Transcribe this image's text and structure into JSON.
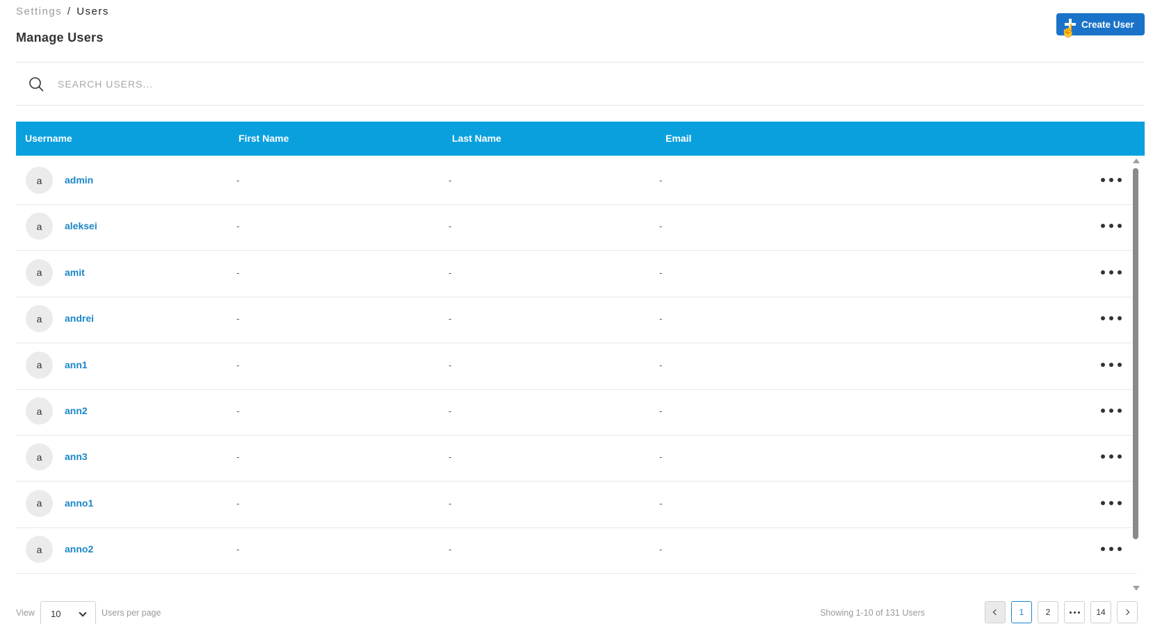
{
  "breadcrumb": {
    "parent": "Settings",
    "separator": "/",
    "current": "Users"
  },
  "page_title": "Manage Users",
  "create_button": {
    "label": "Create User",
    "icon": "plus-icon"
  },
  "search": {
    "placeholder": "SEARCH USERS...",
    "value": "",
    "icon": "search-icon"
  },
  "table": {
    "columns": [
      "Username",
      "First Name",
      "Last Name",
      "Email"
    ],
    "rows": [
      {
        "avatar": "a",
        "username": "admin",
        "first_name": "-",
        "last_name": "-",
        "email": "-"
      },
      {
        "avatar": "a",
        "username": "aleksei",
        "first_name": "-",
        "last_name": "-",
        "email": "-"
      },
      {
        "avatar": "a",
        "username": "amit",
        "first_name": "-",
        "last_name": "-",
        "email": "-"
      },
      {
        "avatar": "a",
        "username": "andrei",
        "first_name": "-",
        "last_name": "-",
        "email": "-"
      },
      {
        "avatar": "a",
        "username": "ann1",
        "first_name": "-",
        "last_name": "-",
        "email": "-"
      },
      {
        "avatar": "a",
        "username": "ann2",
        "first_name": "-",
        "last_name": "-",
        "email": "-"
      },
      {
        "avatar": "a",
        "username": "ann3",
        "first_name": "-",
        "last_name": "-",
        "email": "-"
      },
      {
        "avatar": "a",
        "username": "anno1",
        "first_name": "-",
        "last_name": "-",
        "email": "-"
      },
      {
        "avatar": "a",
        "username": "anno2",
        "first_name": "-",
        "last_name": "-",
        "email": "-"
      }
    ]
  },
  "footer": {
    "view_label": "View",
    "per_page_value": "10",
    "per_page_label": "Users per page",
    "showing_text": "Showing 1-10 of 131 Users",
    "pages": [
      "1",
      "2",
      "14"
    ],
    "current_page": "1"
  },
  "colors": {
    "header_bg": "#0aa0de",
    "primary_button": "#1a73c8",
    "link": "#1a86c8"
  }
}
